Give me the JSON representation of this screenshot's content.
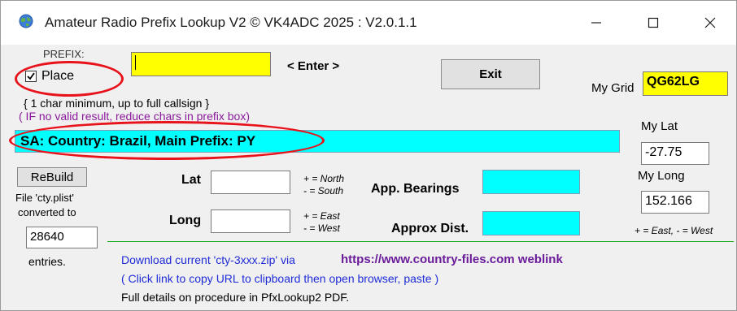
{
  "window": {
    "title": "Amateur Radio Prefix Lookup V2   © VK4ADC 2025 : V2.0.1.1"
  },
  "prefix": {
    "label": "PREFIX:",
    "value": "",
    "enter_hint": "< Enter >",
    "place_label": "Place",
    "place_checked": true,
    "hint_min": "{ 1 char minimum, up to full callsign }",
    "hint_invalid": "( IF no valid result, reduce chars in prefix box)"
  },
  "buttons": {
    "exit": "Exit",
    "rebuild": "ReBuild"
  },
  "mygrid": {
    "label": "My Grid",
    "value": "QG62LG"
  },
  "result": {
    "text": "SA: Country: Brazil, Main Prefix: PY"
  },
  "my_lat": {
    "label": "My Lat",
    "value": "-27.75"
  },
  "my_long": {
    "label": "My Long",
    "value": "152.166",
    "hint": "+ = East, - = West"
  },
  "coords": {
    "lat_label": "Lat",
    "lat_value": "",
    "lat_hint1": "+ = North",
    "lat_hint2": "- = South",
    "long_label": "Long",
    "long_value": "",
    "long_hint1": "+ = East",
    "long_hint2": "- = West"
  },
  "bearings": {
    "label": "App. Bearings",
    "value": "",
    "dist_label": "Approx Dist.",
    "dist_value": ""
  },
  "file": {
    "line1": "File 'cty.plist'",
    "line2": "converted to",
    "count": "28640",
    "entries": "entries."
  },
  "download": {
    "text": "Download current 'cty-3xxx.zip' via",
    "link": "https://www.country-files.com weblink",
    "hint": "( Click link to copy URL to clipboard then open browser, paste )",
    "details": "Full details on procedure in PfxLookup2 PDF."
  },
  "colors": {
    "accent_yellow": "#ffff00",
    "accent_cyan": "#00ffff",
    "highlight_red": "#e8121b",
    "link_purple": "#6a1b9a",
    "hint_blue": "#1e2bd8",
    "divider_green": "#1aa81a"
  },
  "icons": {
    "app": "globe-icon",
    "minimize": "minimize-icon",
    "maximize": "maximize-icon",
    "close": "close-icon",
    "check": "checkmark-icon"
  }
}
